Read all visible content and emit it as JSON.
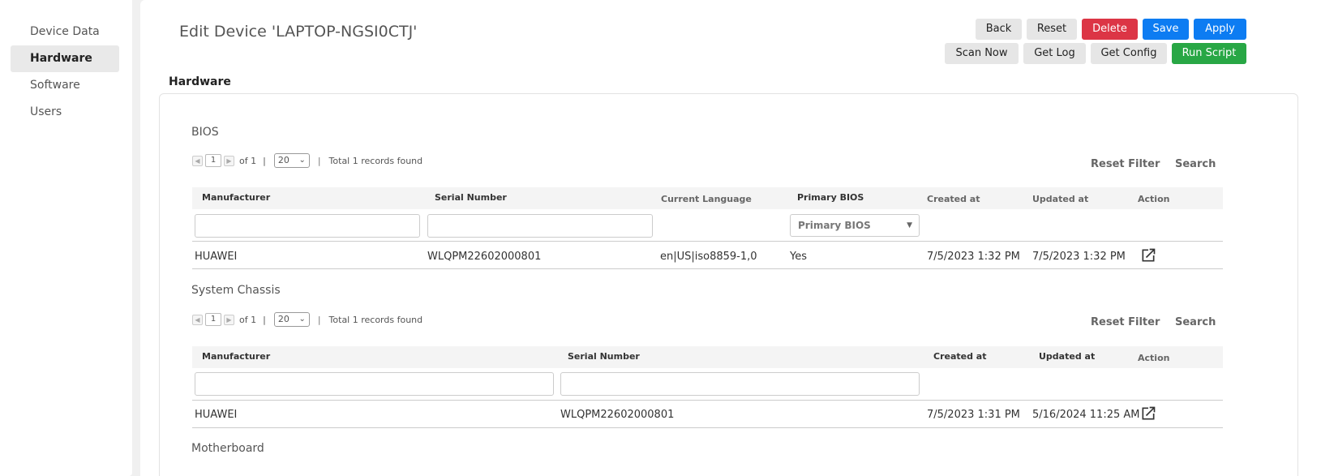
{
  "sidebar": {
    "items": [
      {
        "label": "Device Data"
      },
      {
        "label": "Hardware",
        "active": true
      },
      {
        "label": "Software"
      },
      {
        "label": "Users"
      }
    ]
  },
  "header": {
    "title": "Edit Device 'LAPTOP-NGSI0CTJ'",
    "buttons_row1": [
      "Back",
      "Reset",
      "Delete",
      "Save",
      "Apply"
    ],
    "buttons_row2": [
      "Scan Now",
      "Get Log",
      "Get Config",
      "Run Script"
    ]
  },
  "colors": {
    "danger": "#dc3545",
    "primary": "#0d7cf2",
    "success": "#28a745"
  },
  "section_heading": "Hardware",
  "bios": {
    "title": "BIOS",
    "pager": {
      "page": "1",
      "of": "of 1",
      "page_size": "20",
      "sep": "|",
      "total": "Total 1 records found"
    },
    "reset_filter": "Reset Filter",
    "search": "Search",
    "columns": [
      "Manufacturer",
      "Serial Number",
      "Current Language",
      "Primary BIOS",
      "Created at",
      "Updated at",
      "Action"
    ],
    "primary_filter_placeholder": "Primary BIOS",
    "row": {
      "manufacturer": "HUAWEI",
      "serial": "WLQPM22602000801",
      "language": "en|US|iso8859-1,0",
      "primary": "Yes",
      "created": "7/5/2023 1:32 PM",
      "updated": "7/5/2023 1:32 PM",
      "action_icon": "external-link-icon"
    }
  },
  "chassis": {
    "title": "System Chassis",
    "pager": {
      "page": "1",
      "of": "of 1",
      "page_size": "20",
      "sep": "|",
      "total": "Total 1 records found"
    },
    "reset_filter": "Reset Filter",
    "search": "Search",
    "columns": [
      "Manufacturer",
      "Serial Number",
      "Created at",
      "Updated at",
      "Action"
    ],
    "row": {
      "manufacturer": "HUAWEI",
      "serial": "WLQPM22602000801",
      "created": "7/5/2023 1:31 PM",
      "updated": "5/16/2024 11:25 AM",
      "action_icon": "external-link-icon"
    }
  },
  "motherboard": {
    "title": "Motherboard"
  }
}
